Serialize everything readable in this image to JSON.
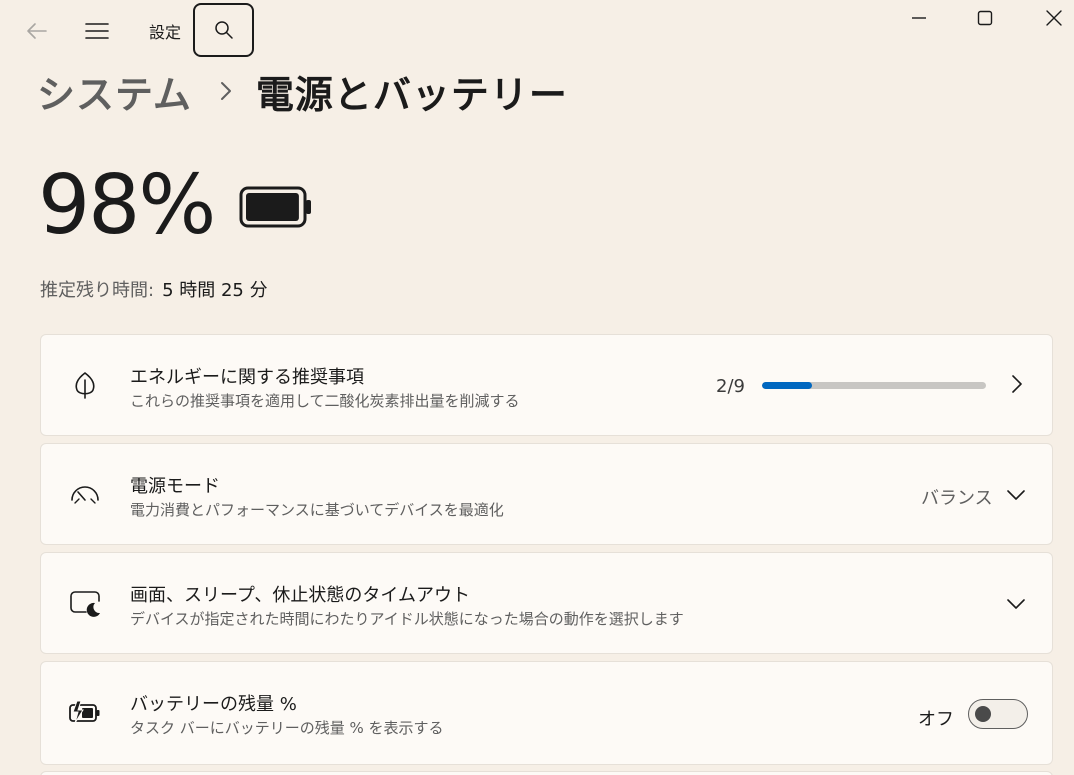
{
  "window": {
    "app_title": "設定",
    "icons": {
      "back": "back-arrow-icon",
      "menu": "hamburger-menu-icon",
      "search": "search-icon",
      "minimize": "minimize-icon",
      "maximize": "maximize-icon",
      "close": "close-icon"
    }
  },
  "breadcrumb": {
    "parent": "システム",
    "separator_icon": "chevron-right-icon",
    "current": "電源とバッテリー"
  },
  "battery": {
    "percent_text": "98%",
    "level_percent": 98,
    "icon": "battery-full-icon",
    "remaining_label": "推定残り時間:",
    "remaining_value": "5 時間 25 分"
  },
  "settings": [
    {
      "title": "エネルギーに関する推奨事項",
      "subtitle": "これらの推奨事項を適用して二酸化炭素排出量を削減する",
      "icon": "leaf-icon",
      "progress_label": "2/9",
      "progress_done": 2,
      "progress_total": 9
    },
    {
      "title": "電源モード",
      "subtitle": "電力消費とパフォーマンスに基づいてデバイスを最適化",
      "icon": "gauge-icon",
      "value": "バランス"
    },
    {
      "title": "画面、スリープ、休止状態のタイムアウト",
      "subtitle": "デバイスが指定された時間にわたりアイドル状態になった場合の動作を選択します",
      "icon": "screen-sleep-icon"
    },
    {
      "title": "バッテリーの残量 %",
      "subtitle": "タスク バーにバッテリーの残量 % を表示する",
      "icon": "battery-charging-icon",
      "toggle_label": "オフ",
      "toggle_on": false
    }
  ],
  "colors": {
    "background": "#f6efe6",
    "card": "#fdfaf6",
    "accent": "#0067c0",
    "progress_track": "#c8c6c3"
  }
}
